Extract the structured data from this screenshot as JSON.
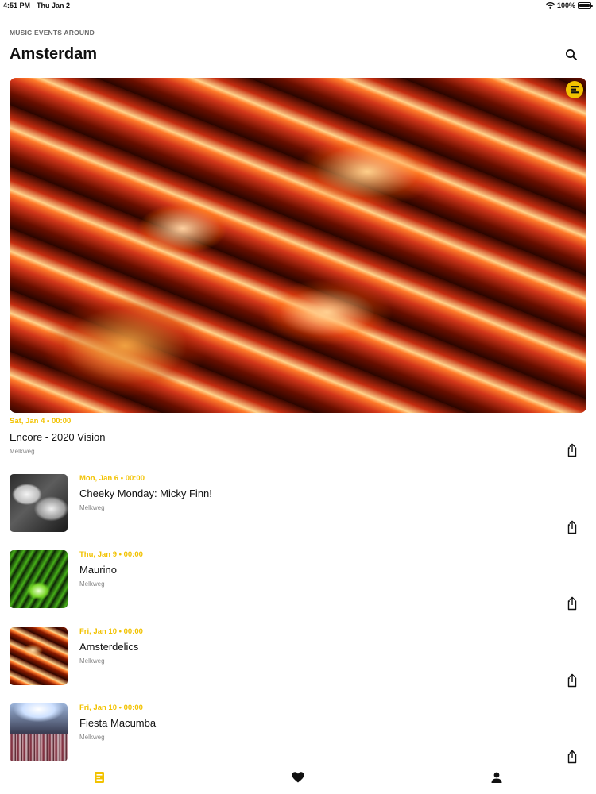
{
  "status": {
    "time": "4:51 PM",
    "date": "Thu Jan 2",
    "battery": "100%"
  },
  "header": {
    "kicker": "MUSIC EVENTS AROUND",
    "city": "Amsterdam"
  },
  "featured": {
    "date": "Sat, Jan 4 • 00:00",
    "title": "Encore - 2020 Vision",
    "venue": "Melkweg"
  },
  "events": [
    {
      "date": "Mon, Jan 6 • 00:00",
      "title": "Cheeky Monday: Micky Finn!",
      "venue": "Melkweg"
    },
    {
      "date": "Thu, Jan 9 • 00:00",
      "title": "Maurino",
      "venue": "Melkweg"
    },
    {
      "date": "Fri, Jan 10 • 00:00",
      "title": "Amsterdelics",
      "venue": "Melkweg"
    },
    {
      "date": "Fri, Jan 10 • 00:00",
      "title": "Fiesta Macumba",
      "venue": "Melkweg"
    }
  ],
  "icons": {
    "search": "search-icon",
    "share": "share-icon",
    "tabs": [
      "events-tab-icon",
      "heart-icon",
      "person-icon"
    ]
  },
  "colors": {
    "accent": "#f2c200",
    "text": "#111111",
    "muted": "#888888"
  }
}
